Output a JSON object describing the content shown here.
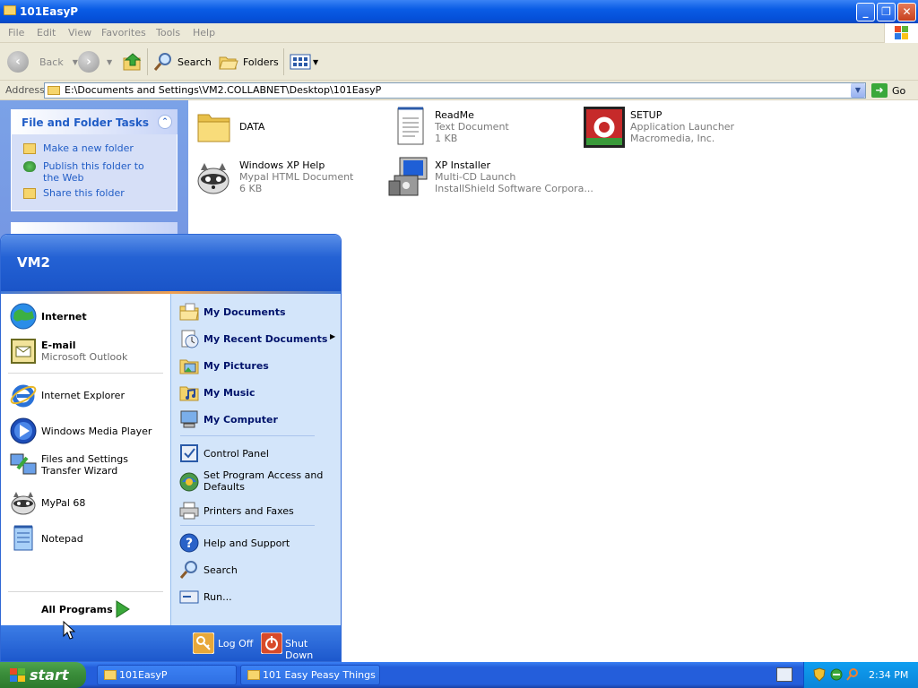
{
  "window": {
    "title": "101EasyP",
    "minimize": "_",
    "maximize": "❐",
    "close": "✕"
  },
  "menubar": [
    "File",
    "Edit",
    "View",
    "Favorites",
    "Tools",
    "Help"
  ],
  "toolbar": {
    "back_label": "Back",
    "search_label": "Search",
    "folders_label": "Folders"
  },
  "address": {
    "label": "Address",
    "value": "E:\\Documents and Settings\\VM2.COLLABNET\\Desktop\\101EasyP",
    "go_label": "Go"
  },
  "tasks": {
    "title": "File and Folder Tasks",
    "items": [
      "Make a new folder",
      "Publish this folder to the Web",
      "Share this folder"
    ]
  },
  "files": [
    {
      "name": "DATA",
      "line1": "",
      "line2": ""
    },
    {
      "name": "ReadMe",
      "line1": "Text Document",
      "line2": "1 KB"
    },
    {
      "name": "SETUP",
      "line1": "Application Launcher",
      "line2": "Macromedia, Inc."
    },
    {
      "name": "Windows XP Help",
      "line1": "Mypal HTML Document",
      "line2": "6 KB"
    },
    {
      "name": "XP Installer",
      "line1": "Multi-CD Launch",
      "line2": "InstallShield Software Corpora..."
    }
  ],
  "startmenu": {
    "user": "VM2",
    "pinned": [
      {
        "name": "Internet",
        "sub": ""
      },
      {
        "name": "E-mail",
        "sub": "Microsoft Outlook"
      }
    ],
    "recent": [
      "Internet Explorer",
      "Windows Media Player",
      "Files and Settings Transfer Wizard",
      "MyPal 68",
      "Notepad"
    ],
    "all_programs": "All Programs",
    "places": [
      "My Documents",
      "My Recent Documents",
      "My Pictures",
      "My Music",
      "My Computer"
    ],
    "system": [
      "Control Panel",
      "Set Program Access and Defaults",
      "Printers and Faxes"
    ],
    "support": [
      "Help and Support",
      "Search",
      "Run..."
    ],
    "logoff": "Log Off",
    "shutdown": "Shut Down"
  },
  "taskbar": {
    "start": "start",
    "tasks": [
      "101EasyP",
      "101 Easy Peasy Things"
    ],
    "clock": "2:34 PM"
  },
  "colors": {
    "xp_blue": "#245edb",
    "start_green": "#3c8f3c",
    "link_blue": "#215dc6"
  }
}
